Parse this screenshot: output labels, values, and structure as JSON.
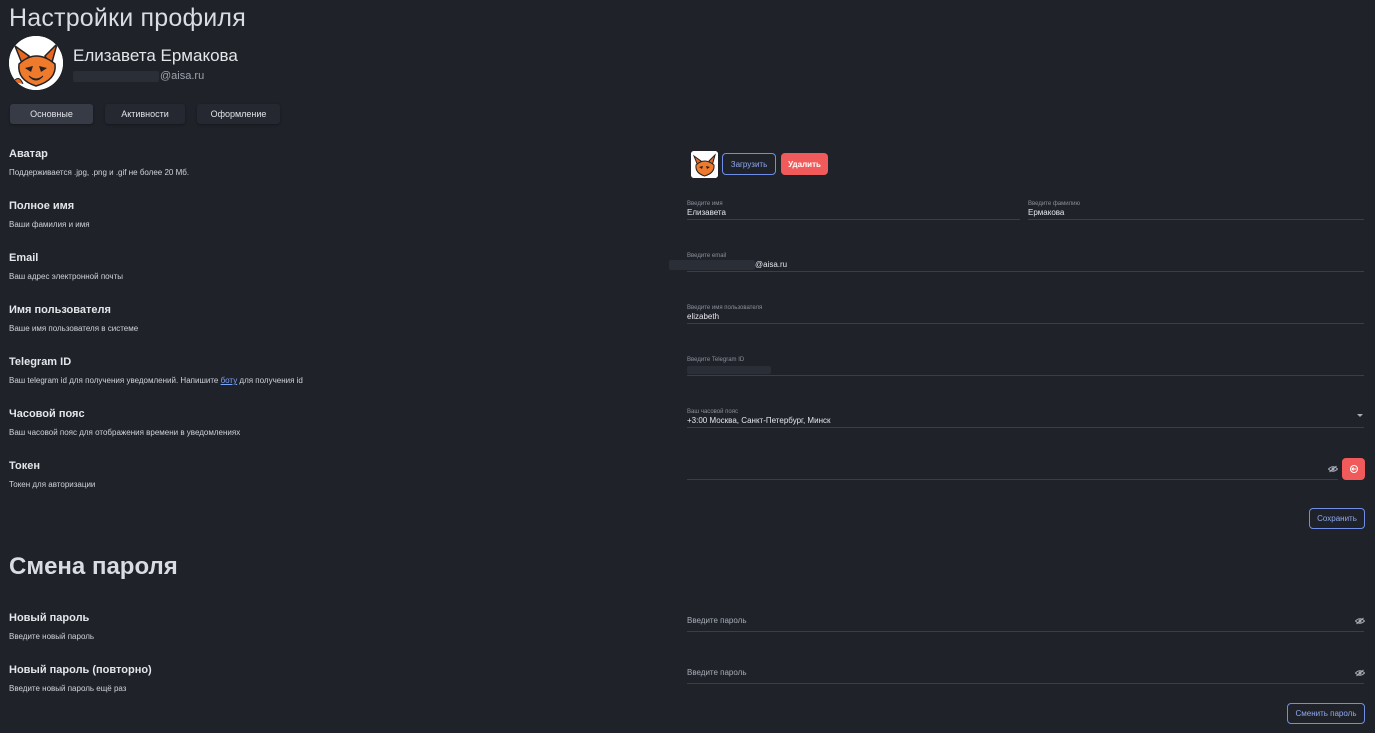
{
  "page_title": "Настройки профиля",
  "user": {
    "name": "Елизавета Ермакова",
    "email_domain": "@aisa.ru"
  },
  "tabs": [
    {
      "label": "Основные",
      "active": true
    },
    {
      "label": "Активности",
      "active": false
    },
    {
      "label": "Оформление",
      "active": false
    }
  ],
  "rows": {
    "avatar": {
      "title": "Аватар",
      "desc": "Поддерживается .jpg, .png и .gif не более 20 Мб."
    },
    "fullname": {
      "title": "Полное имя",
      "desc": "Ваши фамилия и имя"
    },
    "email": {
      "title": "Email",
      "desc": "Ваш адрес электронной почты"
    },
    "username": {
      "title": "Имя пользователя",
      "desc": "Ваше имя пользователя в системе"
    },
    "telegram": {
      "title": "Telegram ID",
      "desc_before": "Ваш telegram id для получения уведомлений. Напишите ",
      "desc_link": "боту",
      "desc_after": " для получения id"
    },
    "timezone": {
      "title": "Часовой пояс",
      "desc": "Ваш часовой пояс для отображения времени в уведомлениях"
    },
    "token": {
      "title": "Токен",
      "desc": "Токен для авторизации"
    },
    "new_password": {
      "title": "Новый пароль",
      "desc": "Введите новый пароль"
    },
    "new_password_repeat": {
      "title": "Новый пароль (повторно)",
      "desc": "Введите новый пароль ещё раз"
    }
  },
  "avatar_buttons": {
    "upload": "Загрузить",
    "delete": "Удалить"
  },
  "fields": {
    "first_name": {
      "label": "Введите имя",
      "value": "Елизавета"
    },
    "last_name": {
      "label": "Введите фамилию",
      "value": "Ермакова"
    },
    "email": {
      "label": "Введите email",
      "value_suffix": "@aisa.ru"
    },
    "username": {
      "label": "Введите имя пользователя",
      "value": "elizabeth"
    },
    "telegram": {
      "label": "Введите Telegram ID"
    },
    "timezone": {
      "label": "Ваш часовой пояс",
      "value": "+3:00 Москва, Санкт-Петербург, Минск"
    },
    "password": {
      "placeholder": "Введите пароль"
    },
    "password_repeat": {
      "placeholder": "Введите пароль"
    }
  },
  "save_button": "Сохранить",
  "password_section_title": "Смена пароля",
  "change_password_button": "Сменить пароль",
  "colors": {
    "background": "#1f2229",
    "accent": "#6f8ee8",
    "danger": "#f05a5a"
  },
  "icons": [
    "fox-avatar-image",
    "eye-off-icon",
    "logout-icon",
    "chevron-down-icon"
  ]
}
